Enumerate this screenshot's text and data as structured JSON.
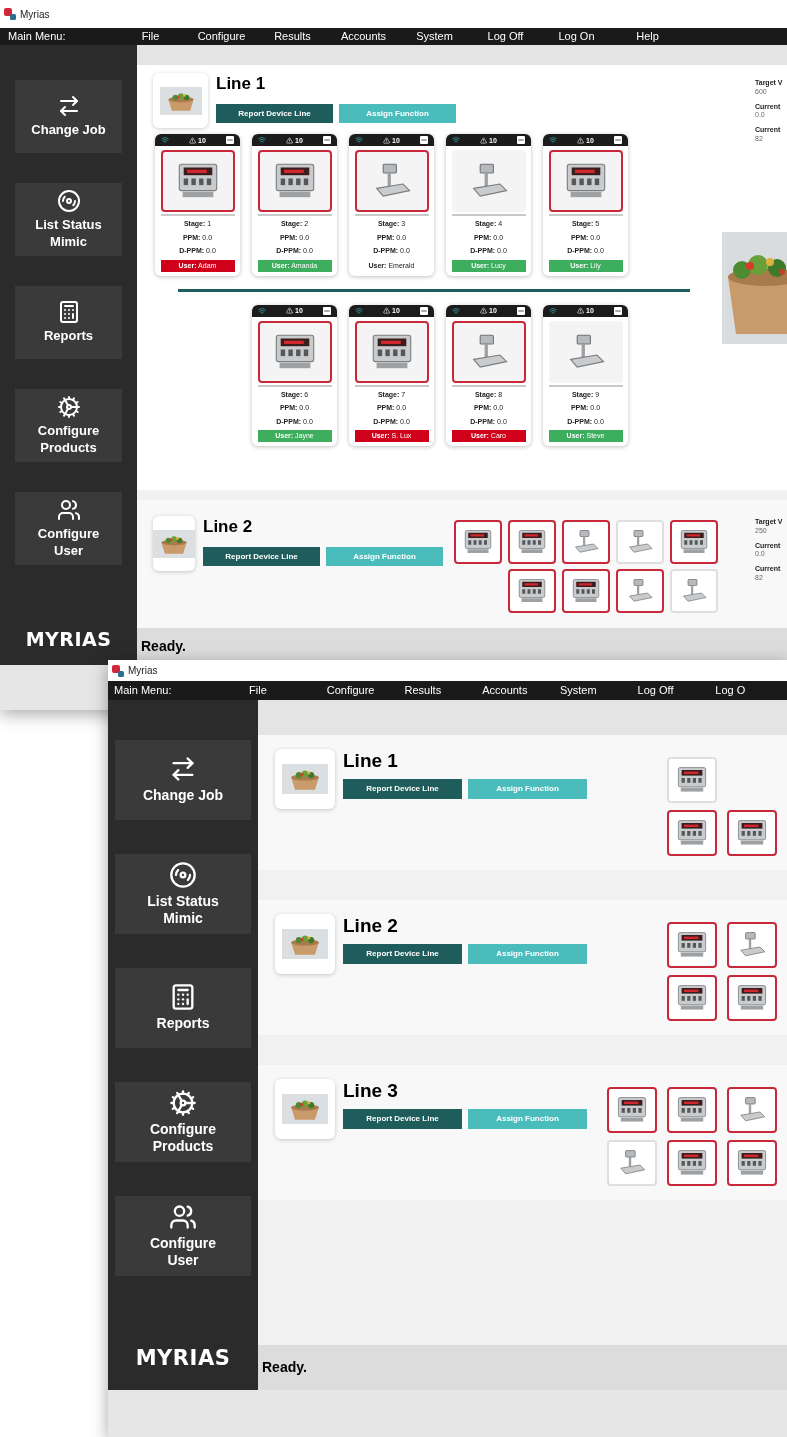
{
  "windows": [
    {
      "title": "Myrias",
      "menu": [
        "Main Menu:",
        "File",
        "Configure",
        "Results",
        "Accounts",
        "System",
        "Log Off",
        "Log On",
        "Help"
      ],
      "sidebar": [
        {
          "label": "Change Job",
          "kind": "arrows"
        },
        {
          "label": "List Status Mimic",
          "kind": "mimic"
        },
        {
          "label": "Reports",
          "kind": "reports"
        },
        {
          "label": "Configure Products",
          "kind": "products"
        },
        {
          "label": "Configure User",
          "kind": "users"
        }
      ],
      "logo": "MYRIAS",
      "status": "Ready.",
      "lines": [
        {
          "name": "Line 1",
          "kind": "detailed",
          "buttons": [
            "Report Device Line",
            "Assign Function"
          ],
          "device_rows": [
            [
              {
                "kind": "indicator",
                "alarm": true,
                "count": "10",
                "stage": "**Stage:** 1",
                "ppm": "**PPM:** 0.0",
                "dppm": "**D-PPM:** 0.0",
                "user": "**User:** Adam",
                "color": "#d0021b"
              },
              {
                "kind": "indicator",
                "alarm": true,
                "count": "10",
                "stage": "**Stage:** 2",
                "ppm": "**PPM:** 0.0",
                "dppm": "**D-PPM:** 0.0",
                "user": "**User:** Amanda",
                "color": "#3dae5e"
              },
              {
                "kind": "scale",
                "alarm": true,
                "count": "10",
                "stage": "**Stage:** 3",
                "ppm": "**PPM:** 0.0",
                "dppm": "**D-PPM:** 0.0",
                "user": "**User:** Emerald"
              },
              {
                "kind": "scale",
                "alarm": false,
                "count": "10",
                "stage": "**Stage:** 4",
                "ppm": "**PPM:** 0.0",
                "dppm": "**D-PPM:** 0.0",
                "user": "**User:** Lucy",
                "color": "#3dae5e"
              },
              {
                "kind": "indicator",
                "alarm": true,
                "count": "10",
                "stage": "**Stage:** 5",
                "ppm": "**PPM:** 0.0",
                "dppm": "**D-PPM:** 0.0",
                "user": "**User:** Lily",
                "color": "#3dae5e"
              }
            ],
            [
              {
                "kind": "indicator",
                "alarm": true,
                "count": "10",
                "stage": "**Stage:** 6",
                "ppm": "**PPM:** 0.0",
                "dppm": "**D-PPM:** 0.0",
                "user": "**User:** Jayne",
                "color": "#3dae5e"
              },
              {
                "kind": "indicator",
                "alarm": true,
                "count": "10",
                "stage": "**Stage:** 7",
                "ppm": "**PPM:** 0.0",
                "dppm": "**D-PPM:** 0.0",
                "user": "**User:** S. Lux",
                "color": "#d0021b"
              },
              {
                "kind": "scale",
                "alarm": true,
                "count": "10",
                "stage": "**Stage:** 8",
                "ppm": "**PPM:** 0.0",
                "dppm": "**D-PPM:** 0.0",
                "user": "**User:** Caro",
                "color": "#d0021b"
              },
              {
                "kind": "scale",
                "alarm": false,
                "count": "10",
                "stage": "**Stage:** 9",
                "ppm": "**PPM:** 0.0",
                "dppm": "**D-PPM:** 0.0",
                "user": "**User:** Steve",
                "color": "#3dae5e"
              }
            ]
          ],
          "stats": [
            {
              "label": "Target V",
              "value": "600"
            },
            {
              "label": "Current",
              "value": "0.0"
            },
            {
              "label": "Current",
              "value": "82"
            }
          ],
          "photo": {
            "kind": "picture"
          }
        },
        {
          "name": "Line 2",
          "kind": "compact",
          "buttons": [
            "Report Device Line",
            "Assign Function"
          ],
          "device_rows": [
            [
              {
                "kind": "indicator",
                "alarm": true
              },
              {
                "kind": "indicator",
                "alarm": true
              },
              {
                "kind": "scale",
                "alarm": true
              },
              {
                "kind": "scale",
                "alarm": false
              },
              {
                "kind": "indicator",
                "alarm": true
              }
            ],
            [
              {
                "kind": "indicator",
                "alarm": true
              },
              {
                "kind": "indicator",
                "alarm": true
              },
              {
                "kind": "scale",
                "alarm": true
              },
              {
                "kind": "scale",
                "alarm": false
              }
            ]
          ],
          "stats": [
            {
              "label": "Target V",
              "value": "250"
            },
            {
              "label": "Current",
              "value": "0.0"
            },
            {
              "label": "Current",
              "value": "82"
            }
          ]
        }
      ]
    },
    {
      "title": "Myrias",
      "menu": [
        "Main Menu:",
        "File",
        "Configure",
        "Results",
        "Accounts",
        "System",
        "Log Off",
        "Log O"
      ],
      "sidebar": [
        {
          "label": "Change Job",
          "kind": "arrows"
        },
        {
          "label": "List Status Mimic",
          "kind": "mimic"
        },
        {
          "label": "Reports",
          "kind": "reports"
        },
        {
          "label": "Configure Products",
          "kind": "products"
        },
        {
          "label": "Configure User",
          "kind": "users"
        }
      ],
      "logo": "MYRIAS",
      "status": "Ready.",
      "lines": [
        {
          "name": "Line 1",
          "kind": "compact",
          "buttons": [
            "Report Device Line",
            "Assign Function"
          ],
          "device_rows": [
            [
              {
                "kind": "indicator",
                "alarm": false
              }
            ],
            [
              {
                "kind": "indicator",
                "alarm": true
              },
              {
                "kind": "indicator",
                "alarm": true
              }
            ]
          ]
        },
        {
          "name": "Line 2",
          "kind": "compact",
          "buttons": [
            "Report Device Line",
            "Assign Function"
          ],
          "device_rows": [
            [
              {
                "kind": "indicator",
                "alarm": true
              },
              {
                "kind": "scale",
                "alarm": true
              }
            ],
            [
              {
                "kind": "indicator",
                "alarm": true
              },
              {
                "kind": "indicator",
                "alarm": true
              }
            ]
          ]
        },
        {
          "name": "Line 3",
          "kind": "compact",
          "buttons": [
            "Report Device Line",
            "Assign Function"
          ],
          "device_rows": [
            [
              {
                "kind": "indicator",
                "alarm": true
              },
              {
                "kind": "indicator",
                "alarm": true
              },
              {
                "kind": "scale",
                "alarm": true
              }
            ],
            [
              {
                "kind": "scale",
                "alarm": false
              },
              {
                "kind": "indicator",
                "alarm": true
              },
              {
                "kind": "indicator",
                "alarm": true
              }
            ]
          ]
        }
      ]
    }
  ]
}
